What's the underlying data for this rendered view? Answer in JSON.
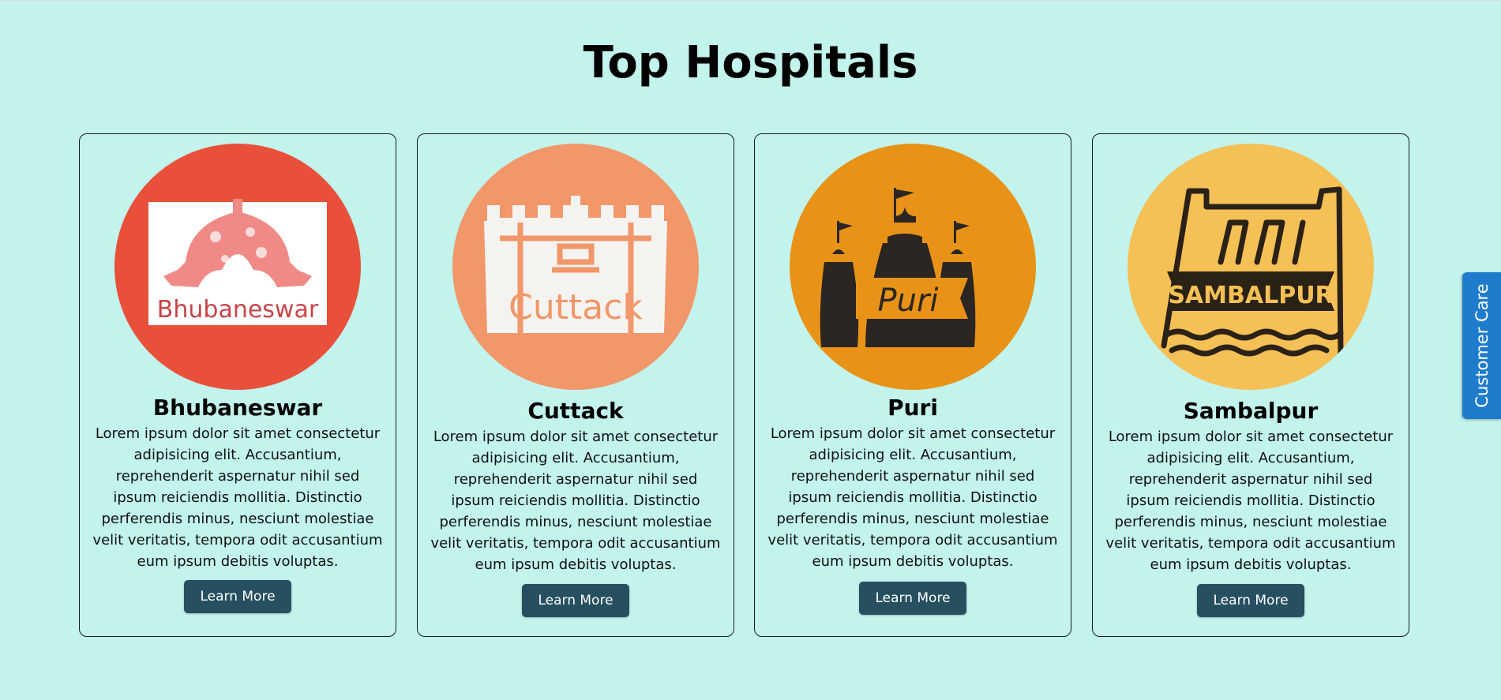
{
  "page": {
    "title": "Top Hospitals"
  },
  "cards": [
    {
      "logo_text": "Bhubaneswar",
      "title": "Bhubaneswar",
      "description": "Lorem ipsum dolor sit amet consectetur adipisicing elit. Accusantium, reprehenderit aspernatur nihil sed ipsum reiciendis mollitia. Distinctio perferendis minus, nesciunt molestiae velit veritatis, tempora odit accusantium eum ipsum debitis voluptas.",
      "button_label": "Learn More",
      "icon": "temple-dome-icon",
      "color": "#e8503a"
    },
    {
      "logo_text": "Cuttack",
      "title": "Cuttack",
      "description": "Lorem ipsum dolor sit amet consectetur adipisicing elit. Accusantium, reprehenderit aspernatur nihil sed ipsum reiciendis mollitia. Distinctio perferendis minus, nesciunt molestiae velit veritatis, tempora odit accusantium eum ipsum debitis voluptas.",
      "button_label": "Learn More",
      "icon": "fort-icon",
      "color": "#f2976a"
    },
    {
      "logo_text": "Puri",
      "title": "Puri",
      "description": "Lorem ipsum dolor sit amet consectetur adipisicing elit. Accusantium, reprehenderit aspernatur nihil sed ipsum reiciendis mollitia. Distinctio perferendis minus, nesciunt molestiae velit veritatis, tempora odit accusantium eum ipsum debitis voluptas.",
      "button_label": "Learn More",
      "icon": "temple-icon",
      "color": "#e89318"
    },
    {
      "logo_text": "SAMBALPUR",
      "title": "Sambalpur",
      "description": "Lorem ipsum dolor sit amet consectetur adipisicing elit. Accusantium, reprehenderit aspernatur nihil sed ipsum reiciendis mollitia. Distinctio perferendis minus, nesciunt molestiae velit veritatis, tempora odit accusantium eum ipsum debitis voluptas.",
      "button_label": "Learn More",
      "icon": "dam-icon",
      "color": "#f5c055"
    }
  ],
  "customer_care": {
    "label": "Customer Care",
    "color": "#1f7ccc"
  },
  "colors": {
    "background": "#c2f3ec",
    "button": "#26505f"
  }
}
